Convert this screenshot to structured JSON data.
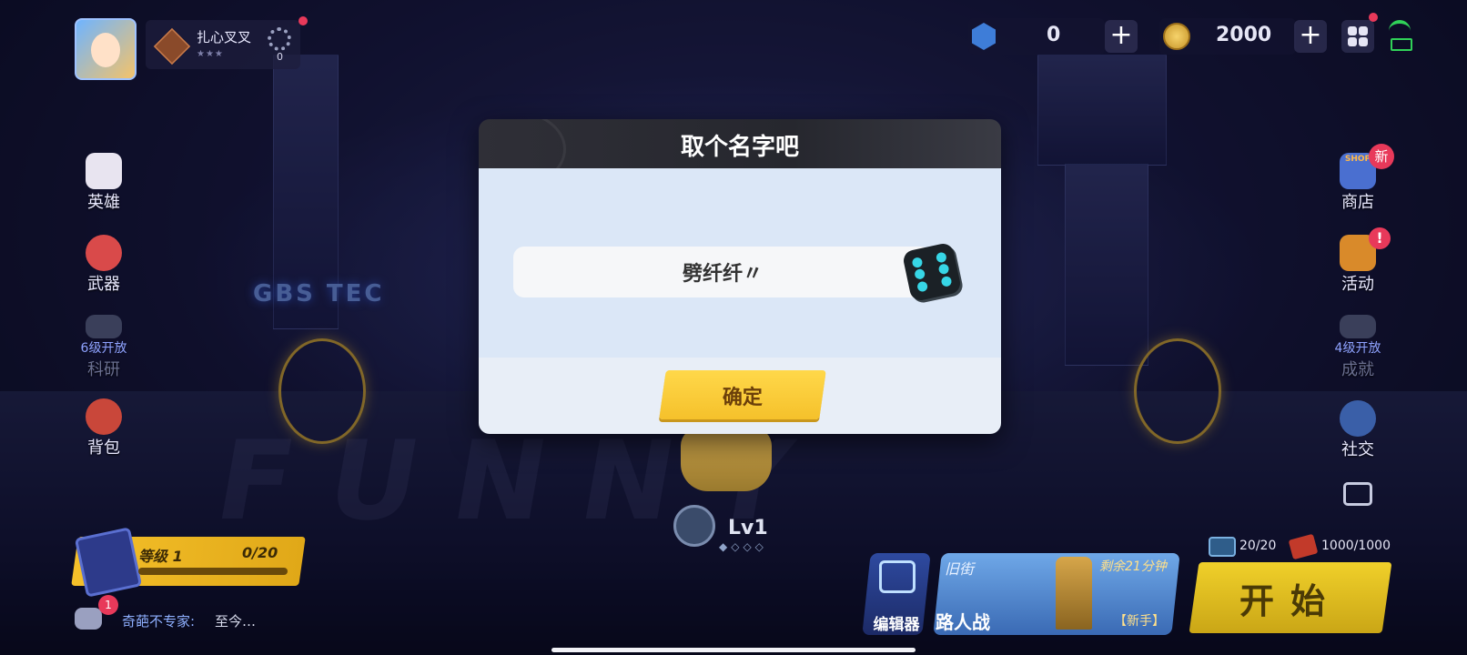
{
  "player": {
    "name": "扎心叉叉",
    "stars": "★★★",
    "gear_count": "0"
  },
  "resources": {
    "gems": "0",
    "coins": "2000"
  },
  "left_menu": [
    {
      "label": "英雄"
    },
    {
      "label": "武器"
    },
    {
      "label": "6级开放",
      "sub": "科研"
    },
    {
      "label": "背包"
    }
  ],
  "right_menu": [
    {
      "label": "商店",
      "badge": "新",
      "icon_text": "SHOP"
    },
    {
      "label": "活动",
      "badge": "!"
    },
    {
      "label": "4级开放",
      "sub": "成就"
    },
    {
      "label": "社交"
    }
  ],
  "scene": {
    "sign": "GBS TEC",
    "floor": "FUNNY"
  },
  "dialog": {
    "title": "取个名字吧",
    "name_value": "劈纤纤〃",
    "confirm_label": "确定"
  },
  "character": {
    "level": "Lv1",
    "level_dots": "◆◇◇◇"
  },
  "xp": {
    "label": "等级 1",
    "value": "0/20",
    "progress": 0
  },
  "chat": {
    "badge": "1",
    "sender": "奇葩不专家:",
    "message": "至今…"
  },
  "play": {
    "editor_label": "编辑器",
    "map_name": "旧街",
    "timer": "剩余21分钟",
    "mode": "路人战",
    "mode_tag": "【新手】",
    "stamina": "20/20",
    "tickets": "1000/1000",
    "start_label": "开始"
  },
  "colors": {
    "accent_yellow": "#f5c12b",
    "badge_red": "#e8395a",
    "dialog_bg": "#dbe7f7"
  }
}
